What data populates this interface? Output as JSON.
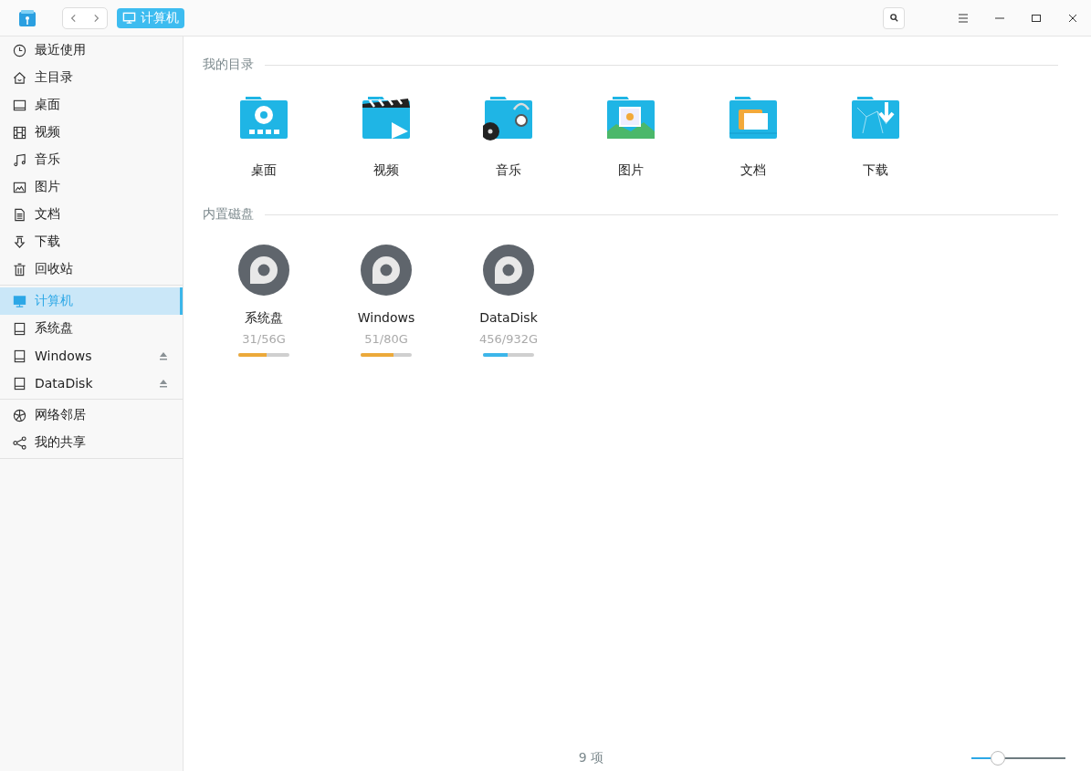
{
  "titlebar": {
    "breadcrumb": "计算机"
  },
  "sidebar": {
    "groups": [
      {
        "items": [
          {
            "label": "最近使用",
            "kind": "clock",
            "selected": false,
            "eject": false
          },
          {
            "label": "主目录",
            "kind": "home",
            "selected": false,
            "eject": false
          },
          {
            "label": "桌面",
            "kind": "desktop",
            "selected": false,
            "eject": false
          },
          {
            "label": "视频",
            "kind": "video",
            "selected": false,
            "eject": false
          },
          {
            "label": "音乐",
            "kind": "music",
            "selected": false,
            "eject": false
          },
          {
            "label": "图片",
            "kind": "picture",
            "selected": false,
            "eject": false
          },
          {
            "label": "文档",
            "kind": "document",
            "selected": false,
            "eject": false
          },
          {
            "label": "下载",
            "kind": "download",
            "selected": false,
            "eject": false
          },
          {
            "label": "回收站",
            "kind": "trash",
            "selected": false,
            "eject": false
          }
        ]
      },
      {
        "items": [
          {
            "label": "计算机",
            "kind": "computer",
            "selected": true,
            "eject": false
          },
          {
            "label": "系统盘",
            "kind": "disk",
            "selected": false,
            "eject": false
          },
          {
            "label": "Windows",
            "kind": "disk",
            "selected": false,
            "eject": true
          },
          {
            "label": "DataDisk",
            "kind": "disk",
            "selected": false,
            "eject": true
          }
        ]
      },
      {
        "items": [
          {
            "label": "网络邻居",
            "kind": "network",
            "selected": false,
            "eject": false
          },
          {
            "label": "我的共享",
            "kind": "share",
            "selected": false,
            "eject": false
          }
        ]
      }
    ]
  },
  "sections": [
    {
      "title": "我的目录",
      "kind": "folders",
      "items": [
        {
          "label": "桌面",
          "kind": "desktop"
        },
        {
          "label": "视频",
          "kind": "video"
        },
        {
          "label": "音乐",
          "kind": "music"
        },
        {
          "label": "图片",
          "kind": "picture"
        },
        {
          "label": "文档",
          "kind": "document"
        },
        {
          "label": "下载",
          "kind": "download"
        }
      ]
    },
    {
      "title": "内置磁盘",
      "kind": "disks",
      "items": [
        {
          "label": "系统盘",
          "usage": "31/56G",
          "level": 0.55,
          "color": "#eca93a"
        },
        {
          "label": "Windows",
          "usage": "51/80G",
          "level": 0.64,
          "color": "#eca93a"
        },
        {
          "label": "DataDisk",
          "usage": "456/932G",
          "level": 0.48,
          "color": "#3cb6ea"
        }
      ]
    }
  ],
  "status_bar": {
    "count": "9 项",
    "zoom_slider": {
      "level": 0.27
    }
  }
}
